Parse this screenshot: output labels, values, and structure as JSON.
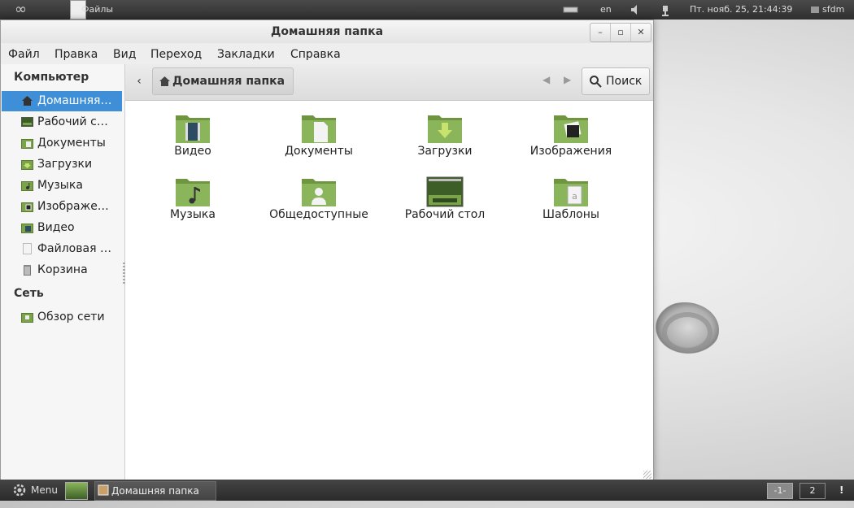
{
  "top_panel": {
    "mint_logo_icon": "infinity-logo",
    "file_label": "Файлы",
    "lang": "en",
    "datetime": "Пт. нояб. 25, 21:44:39",
    "user": "sfdm"
  },
  "window": {
    "title": "Домашняя папка",
    "controls": {
      "minimize": "–",
      "maximize": "▫",
      "close": "✕"
    }
  },
  "menubar": [
    "Файл",
    "Правка",
    "Вид",
    "Переход",
    "Закладки",
    "Справка"
  ],
  "sidebar": {
    "computer_heading": "Компьютер",
    "items": [
      {
        "label": "Домашняя…",
        "icon": "home-icon",
        "selected": true
      },
      {
        "label": "Рабочий с…",
        "icon": "desktop-icon"
      },
      {
        "label": "Документы",
        "icon": "documents-folder-icon"
      },
      {
        "label": "Загрузки",
        "icon": "downloads-folder-icon"
      },
      {
        "label": "Музыка",
        "icon": "music-folder-icon"
      },
      {
        "label": "Изображе…",
        "icon": "pictures-folder-icon"
      },
      {
        "label": "Видео",
        "icon": "videos-folder-icon"
      },
      {
        "label": "Файловая …",
        "icon": "filesystem-icon"
      },
      {
        "label": "Корзина",
        "icon": "trash-icon"
      }
    ],
    "network_heading": "Сеть",
    "network_items": [
      {
        "label": "Обзор сети",
        "icon": "network-icon"
      }
    ]
  },
  "toolbar": {
    "back": "‹",
    "breadcrumb": "Домашняя папка",
    "search": "Поиск"
  },
  "content": {
    "items": [
      {
        "label": "Видео",
        "icon": "video-folder-icon"
      },
      {
        "label": "Документы",
        "icon": "documents-folder-icon"
      },
      {
        "label": "Загрузки",
        "icon": "downloads-folder-icon"
      },
      {
        "label": "Изображения",
        "icon": "pictures-folder-icon"
      },
      {
        "label": "Музыка",
        "icon": "music-folder-icon"
      },
      {
        "label": "Общедоступные",
        "icon": "public-folder-icon"
      },
      {
        "label": "Рабочий стол",
        "icon": "desktop-folder-icon"
      },
      {
        "label": "Шаблоны",
        "icon": "templates-folder-icon"
      }
    ]
  },
  "bottom_panel": {
    "menu_label": "Menu",
    "task_label": "Домашняя папка",
    "workspaces": [
      "-1-",
      "2"
    ],
    "notify": "!"
  },
  "colors": {
    "selection": "#3e8fd8",
    "folder_green": "#7ba34a",
    "panel_dark": "#333333"
  }
}
